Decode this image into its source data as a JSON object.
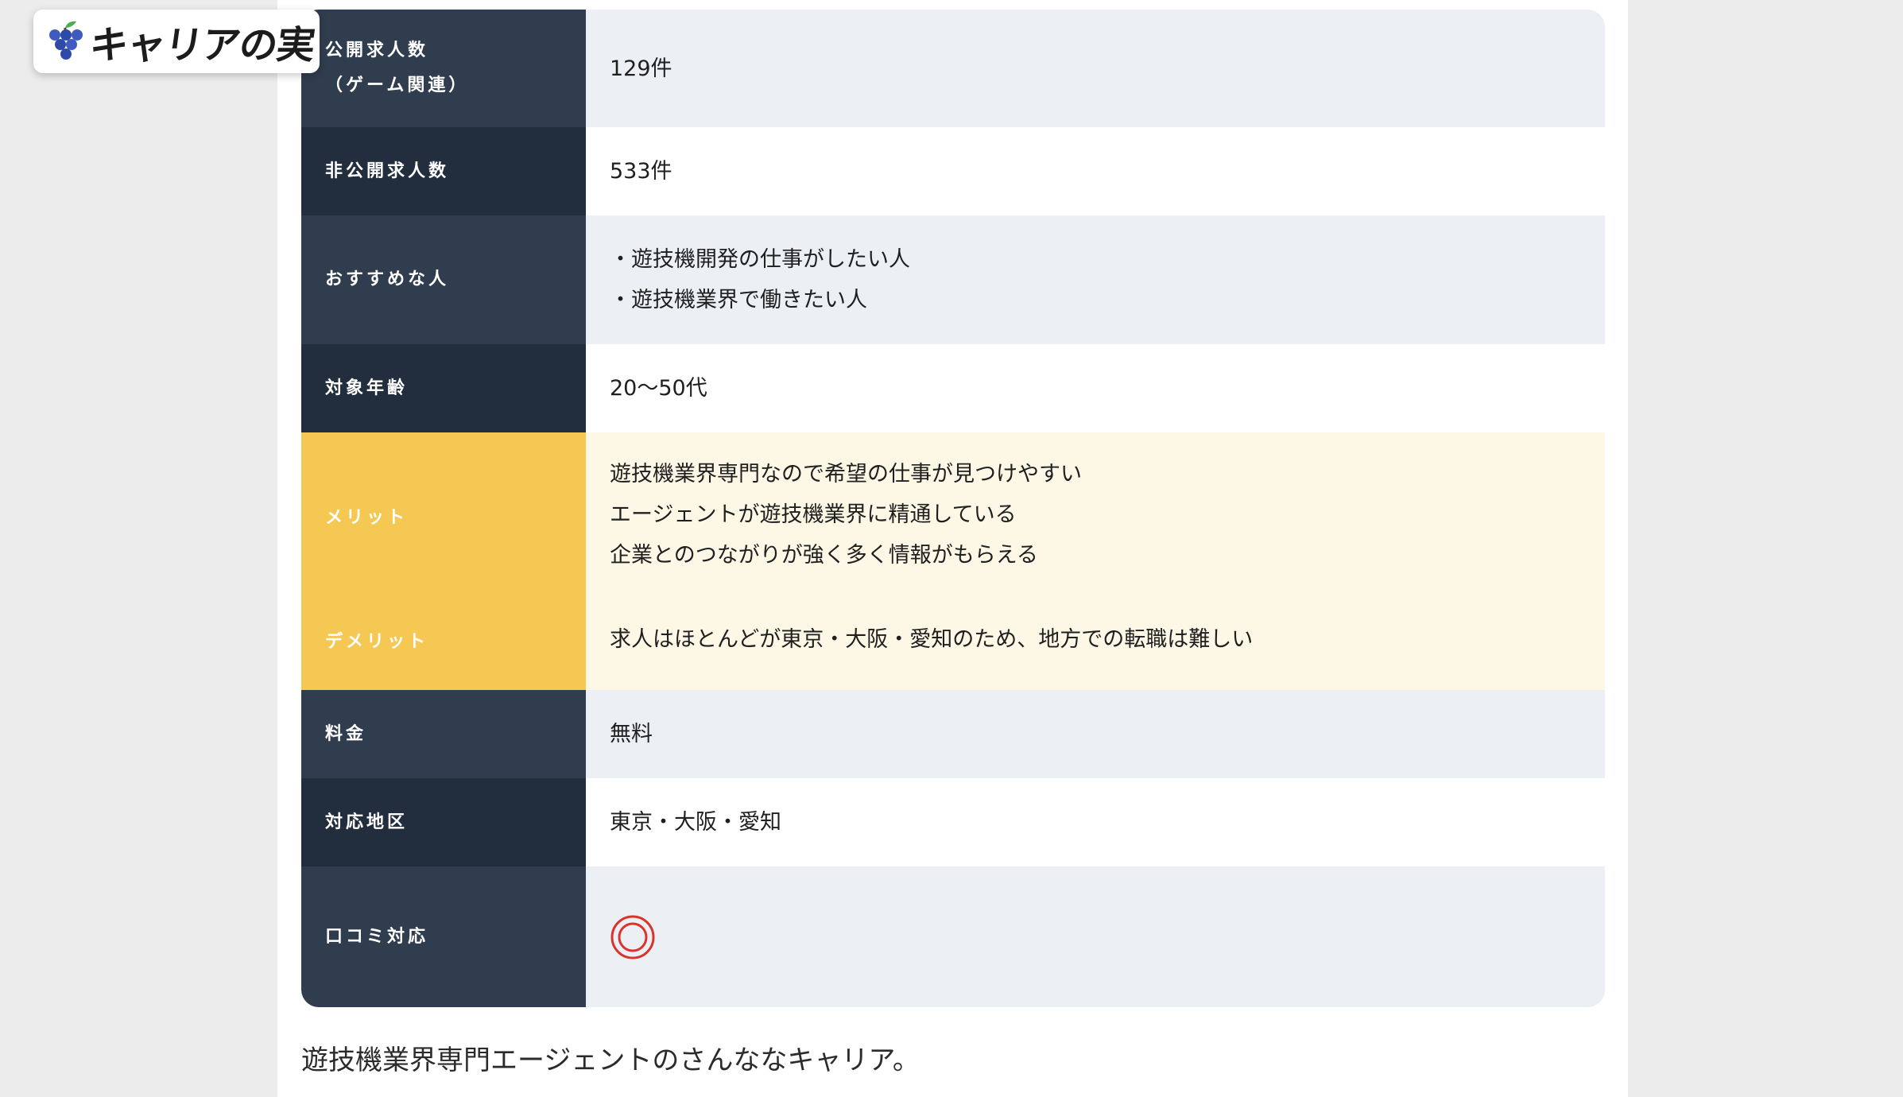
{
  "logo": {
    "text": "キャリアの実"
  },
  "table": {
    "rows": [
      {
        "label_lines": [
          "公開求人数",
          "（ゲーム関連）"
        ],
        "value": "129件"
      },
      {
        "label": "非公開求人数",
        "value": "533件"
      },
      {
        "label": "おすすめな人",
        "values": [
          "・遊技機開発の仕事がしたい人",
          "・遊技機業界で働きたい人"
        ]
      },
      {
        "label": "対象年齢",
        "value": "20〜50代"
      },
      {
        "label": "メリット",
        "values": [
          "遊技機業界専門なので希望の仕事が見つけやすい",
          "エージェントが遊技機業界に精通している",
          "企業とのつながりが強く多く情報がもらえる"
        ]
      },
      {
        "label": "デメリット",
        "value": "求人はほとんどが東京・大阪・愛知のため、地方での転職は難しい"
      },
      {
        "label": "料金",
        "value": "無料"
      },
      {
        "label": "対応地区",
        "value": "東京・大阪・愛知"
      },
      {
        "label": "口コミ対応",
        "icon": "double-circle-icon"
      }
    ]
  },
  "caption": "遊技機業界専門エージェントのさんななキャリア。",
  "colors": {
    "header_dark_a": "#303d4e",
    "header_dark_b": "#222e3e",
    "header_yellow": "#f5c853",
    "cell_grey": "#ecf0f5",
    "cell_cream": "#fdf7e6",
    "mark_red": "#d9342b"
  }
}
